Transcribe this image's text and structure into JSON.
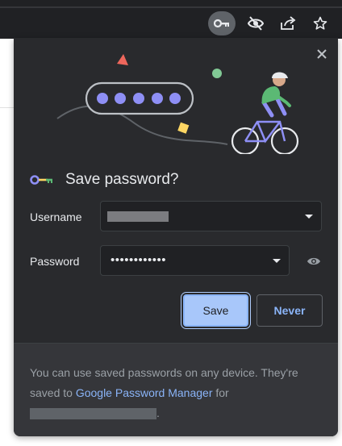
{
  "toolbar": {
    "icons": [
      "key-icon",
      "eye-off-icon",
      "share-icon",
      "star-icon"
    ],
    "active_icon": "key-icon"
  },
  "dialog": {
    "title": "Save password?",
    "username_label": "Username",
    "username_value": "",
    "password_label": "Password",
    "password_value": "••••••••••••",
    "save_label": "Save",
    "never_label": "Never",
    "footer": {
      "text_before": "You can use saved passwords on any device. They're saved to ",
      "link_text": "Google Password Manager",
      "text_after": " for",
      "end_punct": "."
    }
  },
  "colors": {
    "bubble_bg": "#292a2d",
    "accent": "#8ab4f8",
    "save_bg": "#a8c7fa",
    "footer_bg": "#35363a"
  }
}
